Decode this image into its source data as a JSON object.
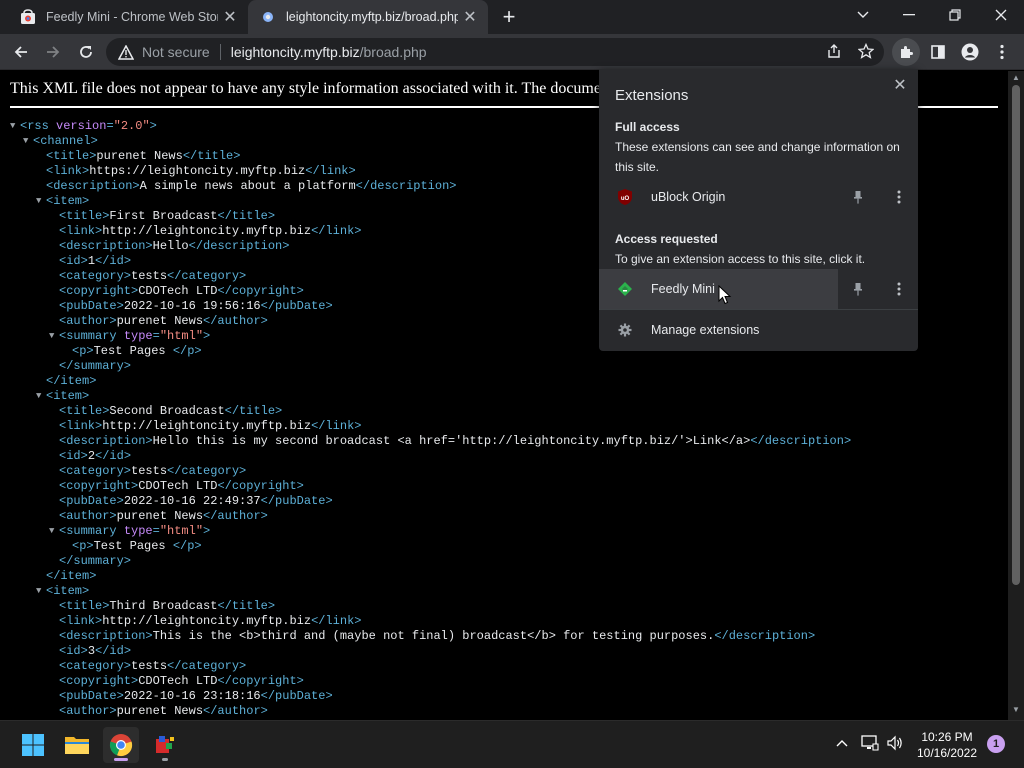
{
  "tabs": [
    {
      "title": "Feedly Mini - Chrome Web Store",
      "active": false,
      "favicon": "chrome-web-store-icon"
    },
    {
      "title": "leightoncity.myftp.biz/broad.php",
      "active": true,
      "favicon": "site-icon"
    }
  ],
  "address_bar": {
    "security_label": "Not secure",
    "host": "leightoncity.myftp.biz",
    "path": "/broad.php"
  },
  "page": {
    "info_message": "This XML file does not appear to have any style information associated with it. The document tree is shown below."
  },
  "xml_lines": [
    {
      "indent": 0,
      "toggle": "open",
      "parts": [
        [
          "t",
          "<rss "
        ],
        [
          "an",
          "version"
        ],
        [
          "t",
          "="
        ],
        [
          "av",
          "\"2.0\""
        ],
        [
          "t",
          ">"
        ]
      ]
    },
    {
      "indent": 1,
      "toggle": "open",
      "parts": [
        [
          "t",
          "<channel>"
        ]
      ]
    },
    {
      "indent": 2,
      "parts": [
        [
          "t",
          "<title>"
        ],
        [
          "tx",
          "purenet News"
        ],
        [
          "t",
          "</title>"
        ]
      ]
    },
    {
      "indent": 2,
      "parts": [
        [
          "t",
          "<link>"
        ],
        [
          "tx",
          "https://leightoncity.myftp.biz"
        ],
        [
          "t",
          "</link>"
        ]
      ]
    },
    {
      "indent": 2,
      "parts": [
        [
          "t",
          "<description>"
        ],
        [
          "tx",
          "A simple news about a platform"
        ],
        [
          "t",
          "</description>"
        ]
      ]
    },
    {
      "indent": 2,
      "toggle": "open",
      "parts": [
        [
          "t",
          "<item>"
        ]
      ]
    },
    {
      "indent": 3,
      "parts": [
        [
          "t",
          "<title>"
        ],
        [
          "tx",
          "First Broadcast"
        ],
        [
          "t",
          "</title>"
        ]
      ]
    },
    {
      "indent": 3,
      "parts": [
        [
          "t",
          "<link>"
        ],
        [
          "tx",
          "http://leightoncity.myftp.biz"
        ],
        [
          "t",
          "</link>"
        ]
      ]
    },
    {
      "indent": 3,
      "parts": [
        [
          "t",
          "<description>"
        ],
        [
          "tx",
          "Hello"
        ],
        [
          "t",
          "</description>"
        ]
      ]
    },
    {
      "indent": 3,
      "parts": [
        [
          "t",
          "<id>"
        ],
        [
          "tx",
          "1"
        ],
        [
          "t",
          "</id>"
        ]
      ]
    },
    {
      "indent": 3,
      "parts": [
        [
          "t",
          "<category>"
        ],
        [
          "tx",
          "tests"
        ],
        [
          "t",
          "</category>"
        ]
      ]
    },
    {
      "indent": 3,
      "parts": [
        [
          "t",
          "<copyright>"
        ],
        [
          "tx",
          "CDOTech LTD"
        ],
        [
          "t",
          "</copyright>"
        ]
      ]
    },
    {
      "indent": 3,
      "parts": [
        [
          "t",
          "<pubDate>"
        ],
        [
          "tx",
          "2022-10-16 19:56:16"
        ],
        [
          "t",
          "</pubDate>"
        ]
      ]
    },
    {
      "indent": 3,
      "parts": [
        [
          "t",
          "<author>"
        ],
        [
          "tx",
          "purenet News"
        ],
        [
          "t",
          "</author>"
        ]
      ]
    },
    {
      "indent": 3,
      "toggle": "open",
      "parts": [
        [
          "t",
          "<summary "
        ],
        [
          "an",
          "type"
        ],
        [
          "t",
          "="
        ],
        [
          "av",
          "\"html\""
        ],
        [
          "t",
          ">"
        ]
      ]
    },
    {
      "indent": 4,
      "parts": [
        [
          "t",
          "<p>"
        ],
        [
          "tx",
          "Test Pages "
        ],
        [
          "t",
          "</p>"
        ]
      ]
    },
    {
      "indent": 3,
      "parts": [
        [
          "t",
          "</summary>"
        ]
      ]
    },
    {
      "indent": 2,
      "parts": [
        [
          "t",
          "</item>"
        ]
      ]
    },
    {
      "indent": 2,
      "toggle": "open",
      "parts": [
        [
          "t",
          "<item>"
        ]
      ]
    },
    {
      "indent": 3,
      "parts": [
        [
          "t",
          "<title>"
        ],
        [
          "tx",
          "Second Broadcast"
        ],
        [
          "t",
          "</title>"
        ]
      ]
    },
    {
      "indent": 3,
      "parts": [
        [
          "t",
          "<link>"
        ],
        [
          "tx",
          "http://leightoncity.myftp.biz"
        ],
        [
          "t",
          "</link>"
        ]
      ]
    },
    {
      "indent": 3,
      "parts": [
        [
          "t",
          "<description>"
        ],
        [
          "tx",
          "Hello this is my second broadcast <a href='http://leightoncity.myftp.biz/'>Link</a>"
        ],
        [
          "t",
          "</description>"
        ]
      ]
    },
    {
      "indent": 3,
      "parts": [
        [
          "t",
          "<id>"
        ],
        [
          "tx",
          "2"
        ],
        [
          "t",
          "</id>"
        ]
      ]
    },
    {
      "indent": 3,
      "parts": [
        [
          "t",
          "<category>"
        ],
        [
          "tx",
          "tests"
        ],
        [
          "t",
          "</category>"
        ]
      ]
    },
    {
      "indent": 3,
      "parts": [
        [
          "t",
          "<copyright>"
        ],
        [
          "tx",
          "CDOTech LTD"
        ],
        [
          "t",
          "</copyright>"
        ]
      ]
    },
    {
      "indent": 3,
      "parts": [
        [
          "t",
          "<pubDate>"
        ],
        [
          "tx",
          "2022-10-16 22:49:37"
        ],
        [
          "t",
          "</pubDate>"
        ]
      ]
    },
    {
      "indent": 3,
      "parts": [
        [
          "t",
          "<author>"
        ],
        [
          "tx",
          "purenet News"
        ],
        [
          "t",
          "</author>"
        ]
      ]
    },
    {
      "indent": 3,
      "toggle": "open",
      "parts": [
        [
          "t",
          "<summary "
        ],
        [
          "an",
          "type"
        ],
        [
          "t",
          "="
        ],
        [
          "av",
          "\"html\""
        ],
        [
          "t",
          ">"
        ]
      ]
    },
    {
      "indent": 4,
      "parts": [
        [
          "t",
          "<p>"
        ],
        [
          "tx",
          "Test Pages "
        ],
        [
          "t",
          "</p>"
        ]
      ]
    },
    {
      "indent": 3,
      "parts": [
        [
          "t",
          "</summary>"
        ]
      ]
    },
    {
      "indent": 2,
      "parts": [
        [
          "t",
          "</item>"
        ]
      ]
    },
    {
      "indent": 2,
      "toggle": "open",
      "parts": [
        [
          "t",
          "<item>"
        ]
      ]
    },
    {
      "indent": 3,
      "parts": [
        [
          "t",
          "<title>"
        ],
        [
          "tx",
          "Third Broadcast"
        ],
        [
          "t",
          "</title>"
        ]
      ]
    },
    {
      "indent": 3,
      "parts": [
        [
          "t",
          "<link>"
        ],
        [
          "tx",
          "http://leightoncity.myftp.biz"
        ],
        [
          "t",
          "</link>"
        ]
      ]
    },
    {
      "indent": 3,
      "parts": [
        [
          "t",
          "<description>"
        ],
        [
          "tx",
          "This is the <b>third and (maybe not final) broadcast</b> for testing purposes."
        ],
        [
          "t",
          "</description>"
        ]
      ]
    },
    {
      "indent": 3,
      "parts": [
        [
          "t",
          "<id>"
        ],
        [
          "tx",
          "3"
        ],
        [
          "t",
          "</id>"
        ]
      ]
    },
    {
      "indent": 3,
      "parts": [
        [
          "t",
          "<category>"
        ],
        [
          "tx",
          "tests"
        ],
        [
          "t",
          "</category>"
        ]
      ]
    },
    {
      "indent": 3,
      "parts": [
        [
          "t",
          "<copyright>"
        ],
        [
          "tx",
          "CDOTech LTD"
        ],
        [
          "t",
          "</copyright>"
        ]
      ]
    },
    {
      "indent": 3,
      "parts": [
        [
          "t",
          "<pubDate>"
        ],
        [
          "tx",
          "2022-10-16 23:18:16"
        ],
        [
          "t",
          "</pubDate>"
        ]
      ]
    },
    {
      "indent": 3,
      "parts": [
        [
          "t",
          "<author>"
        ],
        [
          "tx",
          "purenet News"
        ],
        [
          "t",
          "</author>"
        ]
      ]
    }
  ],
  "extensions_popup": {
    "title": "Extensions",
    "full_access": {
      "heading": "Full access",
      "description": "These extensions can see and change information on this site.",
      "items": [
        {
          "name": "uBlock Origin",
          "icon": "ublock-origin-icon"
        }
      ]
    },
    "access_requested": {
      "heading": "Access requested",
      "description": "To give an extension access to this site, click it.",
      "items": [
        {
          "name": "Feedly Mini",
          "icon": "feedly-icon",
          "hovered": true
        }
      ]
    },
    "manage_label": "Manage extensions"
  },
  "taskbar": {
    "apps": [
      "start-icon",
      "file-explorer-icon",
      "chrome-icon",
      "paint-app-icon"
    ],
    "time": "10:26 PM",
    "date": "10/16/2022",
    "notification_count": "1"
  },
  "colors": {
    "xml_tag": "#5db0d7",
    "xml_attr_name": "#c58af9",
    "xml_attr_value": "#f28b82",
    "popup_bg": "#292a2d",
    "toolbar_bg": "#35363a",
    "tabstrip_bg": "#202124",
    "feedly_green": "#2bb24c",
    "ublock_red": "#800000"
  }
}
